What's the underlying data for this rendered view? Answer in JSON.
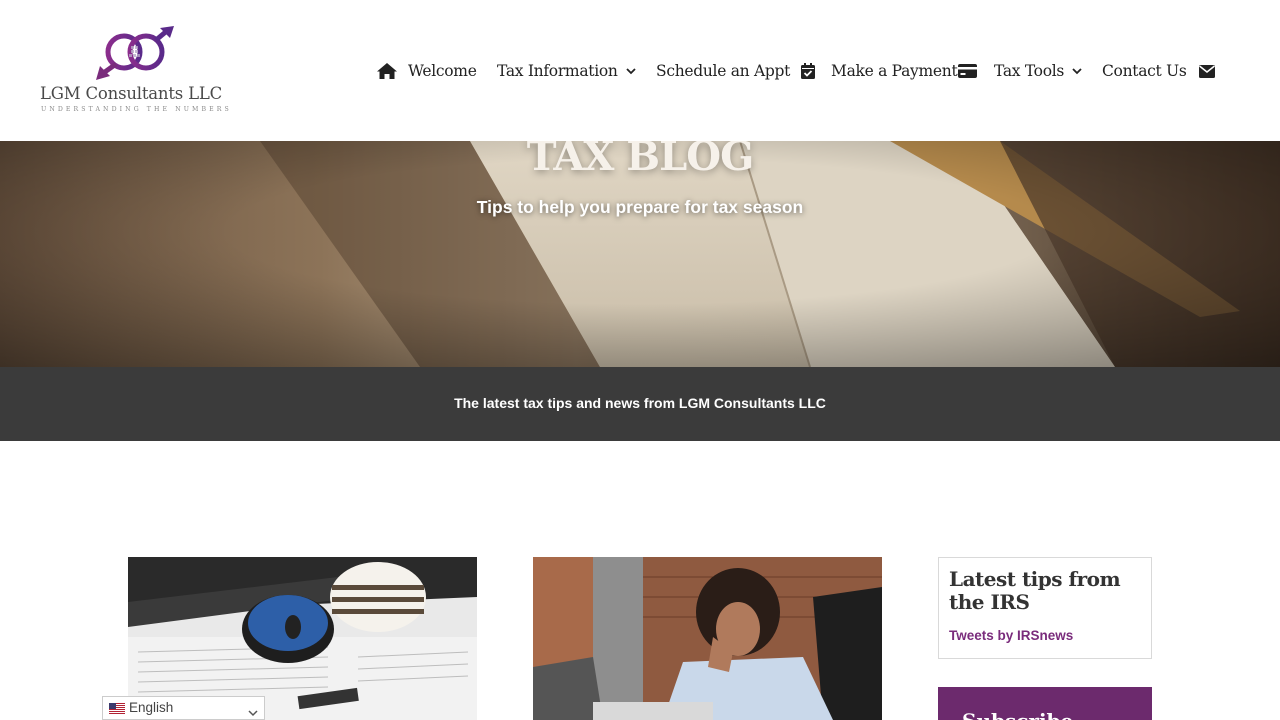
{
  "brand": {
    "name": "LGM Consultants LLC",
    "tagline": "UNDERSTANDING THE NUMBERS",
    "accent_color": "#7a2c7c"
  },
  "nav": {
    "items": [
      {
        "label": "Welcome",
        "icon": "home-icon"
      },
      {
        "label": "Tax Information",
        "icon": "chevron-down-icon"
      },
      {
        "label": "Schedule an Appt",
        "icon": "calendar-check-icon"
      },
      {
        "label": "Make a Payment",
        "icon": "credit-card-icon"
      },
      {
        "label": "Tax Tools",
        "icon": "chevron-down-icon"
      },
      {
        "label": "Contact Us",
        "icon": "envelope-icon"
      }
    ]
  },
  "hero": {
    "title": "TAX BLOG",
    "subtitle": "Tips to help you prepare for tax season"
  },
  "band": {
    "text": "The latest tax tips and news from LGM Consultants LLC"
  },
  "sidebar": {
    "irs_title": "Latest tips from the IRS",
    "irs_link": "Tweets by IRSnews",
    "subscribe_title": "Subscribe",
    "subscribe_color": "#6c2a6d"
  },
  "language": {
    "selected": "English",
    "flag_icon": "us-flag-icon"
  }
}
